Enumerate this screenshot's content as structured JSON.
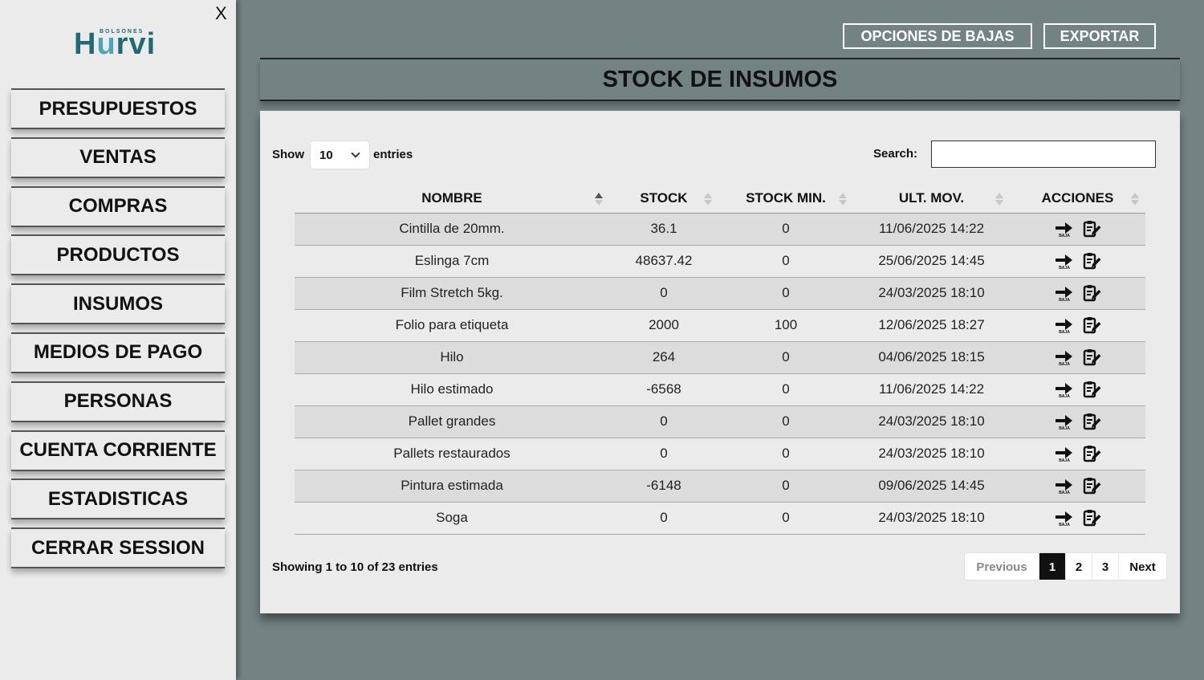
{
  "sidebar": {
    "close_label": "X",
    "logo": {
      "small": "BOLSONES",
      "big_prefix": "H",
      "big_u": "u",
      "big_suffix": "rvi"
    },
    "items": [
      {
        "label": "PRESUPUESTOS"
      },
      {
        "label": "VENTAS"
      },
      {
        "label": "COMPRAS"
      },
      {
        "label": "PRODUCTOS"
      },
      {
        "label": "INSUMOS"
      },
      {
        "label": "MEDIOS DE PAGO"
      },
      {
        "label": "PERSONAS"
      },
      {
        "label": "CUENTA CORRIENTE"
      },
      {
        "label": "ESTADISTICAS"
      },
      {
        "label": "CERRAR SESSION"
      }
    ]
  },
  "toolbar": {
    "bajas_label": "OPCIONES DE BAJAS",
    "export_label": "EXPORTAR"
  },
  "page": {
    "title": "STOCK DE INSUMOS"
  },
  "table_controls": {
    "show_label": "Show",
    "entries_value": "10",
    "entries_label": "entries",
    "search_label": "Search:",
    "search_value": ""
  },
  "table": {
    "columns": [
      "NOMBRE",
      "STOCK",
      "STOCK MIN.",
      "ULT. MOV.",
      "ACCIONES"
    ],
    "rows": [
      {
        "nombre": "Cintilla de 20mm.",
        "stock": "36.1",
        "stock_min": "0",
        "ult_mov": "11/06/2025 14:22"
      },
      {
        "nombre": "Eslinga 7cm",
        "stock": "48637.42",
        "stock_min": "0",
        "ult_mov": "25/06/2025 14:45"
      },
      {
        "nombre": "Film Stretch 5kg.",
        "stock": "0",
        "stock_min": "0",
        "ult_mov": "24/03/2025 18:10"
      },
      {
        "nombre": "Folio para etiqueta",
        "stock": "2000",
        "stock_min": "100",
        "ult_mov": "12/06/2025 18:27"
      },
      {
        "nombre": "Hilo",
        "stock": "264",
        "stock_min": "0",
        "ult_mov": "04/06/2025 18:15"
      },
      {
        "nombre": "Hilo estimado",
        "stock": "-6568",
        "stock_min": "0",
        "ult_mov": "11/06/2025 14:22"
      },
      {
        "nombre": "Pallet grandes",
        "stock": "0",
        "stock_min": "0",
        "ult_mov": "24/03/2025 18:10"
      },
      {
        "nombre": "Pallets restaurados",
        "stock": "0",
        "stock_min": "0",
        "ult_mov": "24/03/2025 18:10"
      },
      {
        "nombre": "Pintura estimada",
        "stock": "-6148",
        "stock_min": "0",
        "ult_mov": "09/06/2025 14:45"
      },
      {
        "nombre": "Soga",
        "stock": "0",
        "stock_min": "0",
        "ult_mov": "24/03/2025 18:10"
      }
    ],
    "baja_icon_text": "BAJA",
    "icons": {
      "baja": "arrow-right-baja-icon",
      "edit": "edit-document-icon"
    }
  },
  "footer": {
    "info": "Showing 1 to 10 of 23 entries",
    "prev": "Previous",
    "pages": [
      "1",
      "2",
      "3"
    ],
    "next": "Next"
  }
}
